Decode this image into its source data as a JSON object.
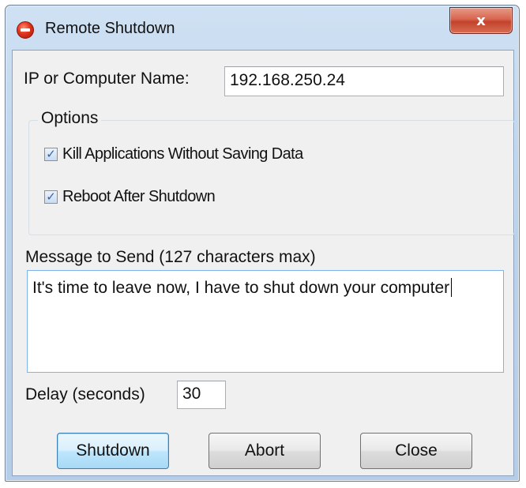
{
  "window": {
    "title": "Remote Shutdown",
    "close_glyph": "x",
    "icon": "stop-icon"
  },
  "form": {
    "ip_label": "IP or Computer Name:",
    "ip_value": "192.168.250.24",
    "options_label": "Options",
    "kill_apps_label": "Kill Applications Without Saving Data",
    "kill_apps_checked": true,
    "reboot_label": "Reboot After Shutdown",
    "reboot_checked": true,
    "message_label": "Message to Send (127 characters max)",
    "message_value": "It's time to leave now, I have to shut down your computer",
    "delay_label": "Delay (seconds)",
    "delay_value": "30"
  },
  "buttons": {
    "shutdown": "Shutdown",
    "abort": "Abort",
    "close": "Close"
  },
  "colors": {
    "title_close_button": "#c3422b",
    "focus_border": "#7eb4ea",
    "default_button": "#3c7fb1"
  }
}
